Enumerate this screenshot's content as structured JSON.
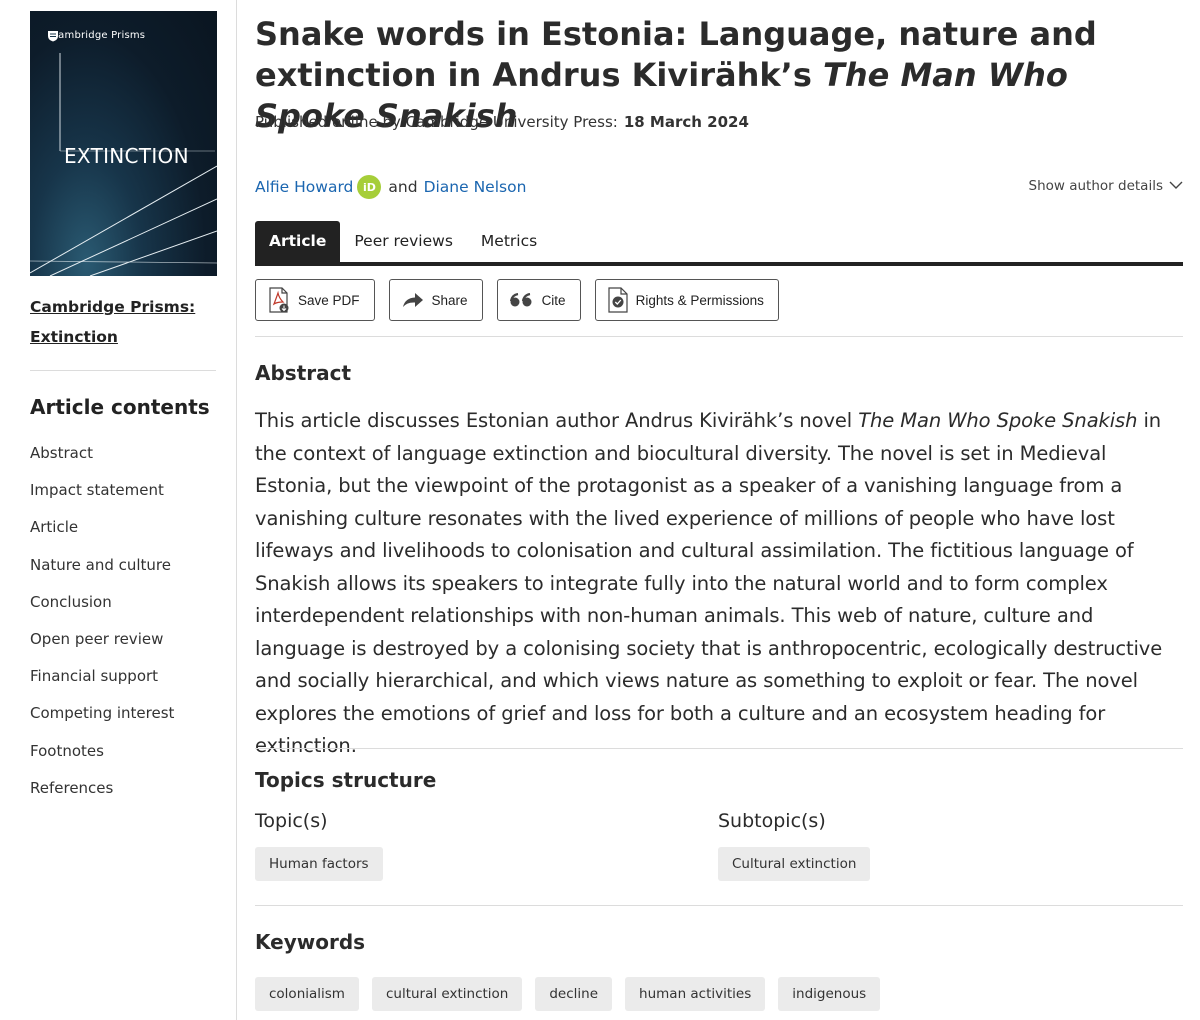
{
  "sidebar": {
    "cover": {
      "brand": "Cambridge Prisms",
      "title": "EXTINCTION"
    },
    "journal_link": "Cambridge Prisms: Extinction",
    "contents_heading": "Article contents",
    "contents": [
      "Abstract",
      "Impact statement",
      "Article",
      "Nature and culture",
      "Conclusion",
      "Open peer review",
      "Financial support",
      "Competing interest",
      "Footnotes",
      "References"
    ]
  },
  "article": {
    "title_part1": "Snake words in Estonia: Language, nature and extinction in Andrus Kivirähk’s ",
    "title_italic": "The Man Who Spoke Snakish",
    "published_label": "Published online by Cambridge University Press:",
    "published_date": "18 March 2024",
    "authors": {
      "first": "Alfie Howard",
      "orcid": "iD",
      "and": "and",
      "second": "Diane Nelson"
    },
    "author_details": "Show author details"
  },
  "tabs": [
    "Article",
    "Peer reviews",
    "Metrics"
  ],
  "toolbar": {
    "save_pdf": "Save PDF",
    "share": "Share",
    "cite": "Cite",
    "rights": "Rights & Permissions"
  },
  "abstract": {
    "heading": "Abstract",
    "text_part1": "This article discusses Estonian author Andrus Kivirähk’s novel ",
    "text_italic": "The Man Who Spoke Snakish",
    "text_part2": " in the context of language extinction and biocultural diversity. The novel is set in Medieval Estonia, but the viewpoint of the protagonist as a speaker of a vanishing language from a vanishing culture resonates with the lived experience of millions of people who have lost lifeways and livelihoods to colonisation and cultural assimilation. The fictitious language of Snakish allows its speakers to integrate fully into the natural world and to form complex interdependent relationships with non-human animals. This web of nature, culture and language is destroyed by a colonising society that is anthropocentric, ecologically destructive and socially hierarchical, and which views nature as something to exploit or fear. The novel explores the emotions of grief and loss for both a culture and an ecosystem heading for extinction."
  },
  "topics": {
    "heading": "Topics structure",
    "topic_label": "Topic(s)",
    "topic": "Human factors",
    "subtopic_label": "Subtopic(s)",
    "subtopic": "Cultural extinction"
  },
  "keywords": {
    "heading": "Keywords",
    "items": [
      "colonialism",
      "cultural extinction",
      "decline",
      "human activities",
      "indigenous"
    ]
  },
  "colors": {
    "link": "#1b66b0",
    "orcid": "#a6ce39",
    "tab_active": "#222222",
    "chip_bg": "#ebebeb"
  }
}
